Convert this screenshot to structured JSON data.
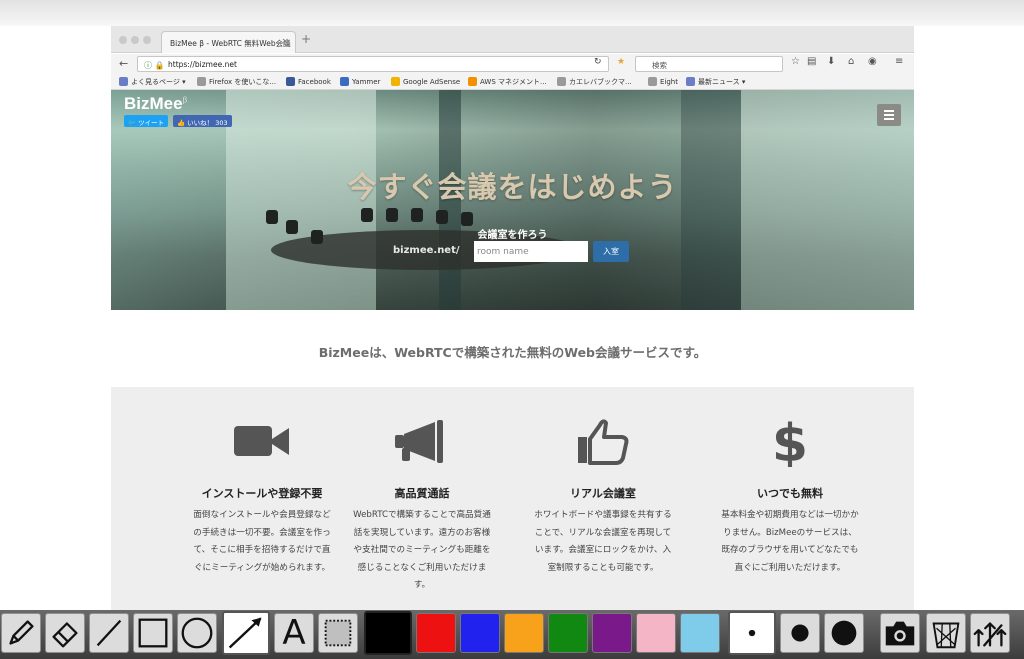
{
  "browser": {
    "tab_title": "BizMee β - WebRTC 無料Web会議",
    "tab_close": "×",
    "new_tab": "+",
    "url": "https://bizmee.net",
    "search_placeholder": "検索",
    "bookmarks": [
      {
        "label": "よく見るページ ▾",
        "color": "#6b7dc8"
      },
      {
        "label": "Firefox を使いこな...",
        "color": "#9a9a9a"
      },
      {
        "label": "Facebook",
        "color": "#3b5998"
      },
      {
        "label": "Yammer",
        "color": "#396dbd"
      },
      {
        "label": "Google AdSense",
        "color": "#f0b400"
      },
      {
        "label": "AWS マネジメント...",
        "color": "#f29100"
      },
      {
        "label": "カエレバブックマ...",
        "color": "#9a9a9a"
      },
      {
        "label": "Eight",
        "color": "#9a9a9a"
      },
      {
        "label": "最新ニュース ▾",
        "color": "#6b7dc8"
      }
    ]
  },
  "site": {
    "logo": "BizMee",
    "logo_beta": "β",
    "tweet_label": "ツイート",
    "like_label": "いいね！ 303",
    "headline": "今すぐ会議をはじめよう",
    "room_label": "会議室を作ろう",
    "room_prefix": "bizmee.net/",
    "room_placeholder": "room name",
    "enter_button": "入室",
    "tagline": "BizMeeは、WebRTCで構築された無料のWeb会議サービスです。",
    "features": [
      {
        "icon": "video-camera-icon",
        "title": "インストールや登録不要",
        "lines": [
          "面倒なインストールや会員登録など",
          "の手続きは一切不要。会議室を作っ",
          "て、そこに相手を招待するだけで直",
          "ぐにミーティングが始められます。"
        ]
      },
      {
        "icon": "megaphone-icon",
        "title": "高品質通話",
        "lines": [
          "WebRTCで構築することで高品質通",
          "話を実現しています。遠方のお客様",
          "や支社間でのミーティングも距離を",
          "感じることなくご利用いただけま",
          "す。"
        ]
      },
      {
        "icon": "thumbs-up-icon",
        "title": "リアル会議室",
        "lines": [
          "ホワイトボードや議事録を共有する",
          "ことで、リアルな会議室を再現して",
          "います。会議室にロックをかけ、入",
          "室制限することも可能です。"
        ]
      },
      {
        "icon": "dollar-icon",
        "title": "いつでも無料",
        "lines": [
          "基本料金や初期費用などは一切かか",
          "りません。BizMeeのサービスは、",
          "既存のブラウザを用いてどなたでも",
          "直ぐにご利用いただけます。"
        ]
      }
    ]
  },
  "toolbar": {
    "text_tool_label": "A",
    "colors": [
      "#000000",
      "#ee1111",
      "#2222ee",
      "#f7a21a",
      "#118811",
      "#7a1a8a",
      "#f4b6c6",
      "#7ecbea"
    ]
  }
}
